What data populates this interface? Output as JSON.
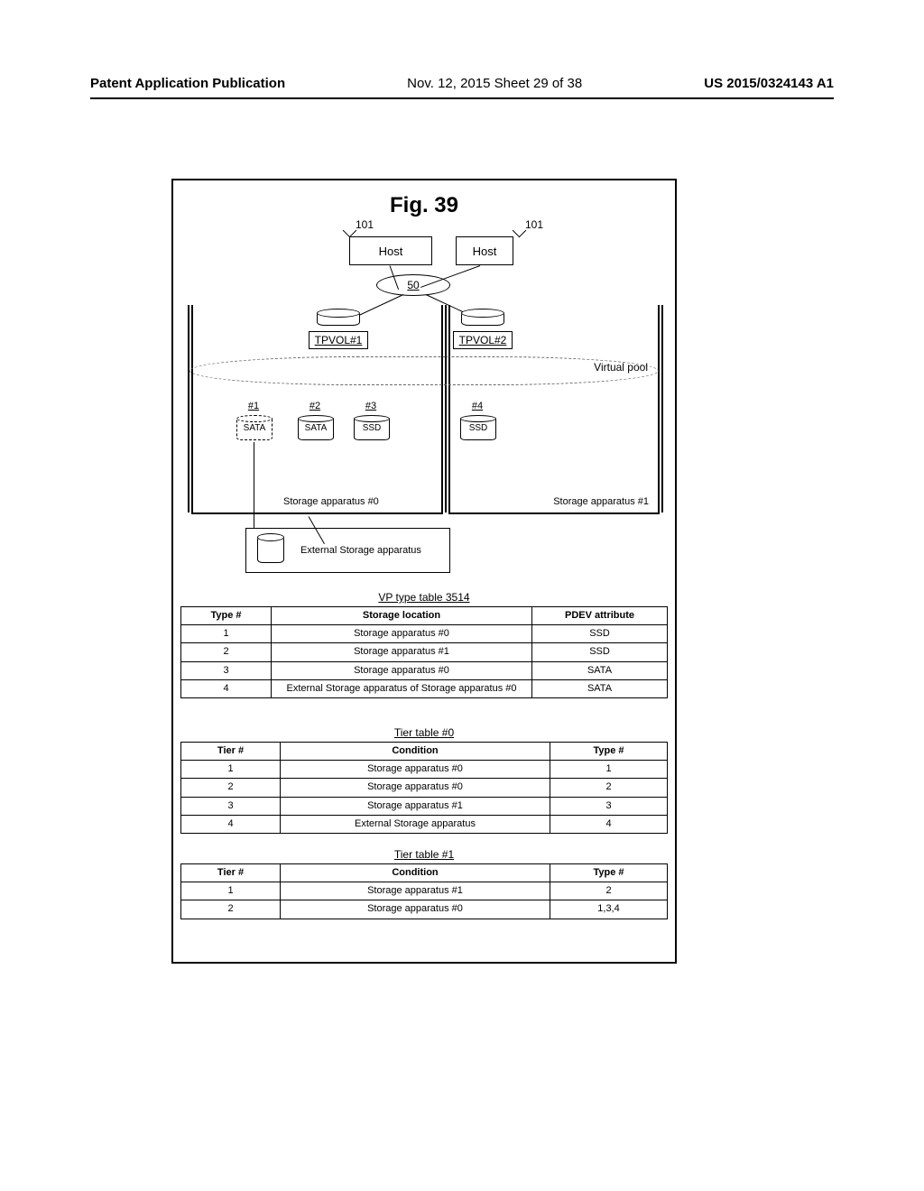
{
  "header": {
    "left_label": "Patent Application Publication",
    "center": "Nov. 12, 2015  Sheet 29 of 38",
    "right": "US 2015/0324143 A1"
  },
  "figure": {
    "title": "Fig. 39",
    "ref101": "101",
    "host1": "Host",
    "host2": "Host",
    "network": "50",
    "tpvol1": "TPVOL#1",
    "tpvol2": "TPVOL#2",
    "vpool": "Virtual pool",
    "app0_label": "Storage apparatus #0",
    "app1_label": "Storage apparatus #1",
    "ext_label": "External Storage apparatus",
    "disks": [
      {
        "num": "#1",
        "lbl": "SATA"
      },
      {
        "num": "#2",
        "lbl": "SATA"
      },
      {
        "num": "#3",
        "lbl": "SSD"
      },
      {
        "num": "#4",
        "lbl": "SSD"
      }
    ]
  },
  "vp_table": {
    "title": "VP type table  3514",
    "headers": [
      "Type #",
      "Storage location",
      "PDEV attribute"
    ],
    "rows": [
      [
        "1",
        "Storage apparatus #0",
        "SSD"
      ],
      [
        "2",
        "Storage apparatus #1",
        "SSD"
      ],
      [
        "3",
        "Storage apparatus #0",
        "SATA"
      ],
      [
        "4",
        "External Storage apparatus of Storage apparatus #0",
        "SATA"
      ]
    ]
  },
  "tier0": {
    "title": "Tier table #0",
    "headers": [
      "Tier #",
      "Condition",
      "Type #"
    ],
    "rows": [
      [
        "1",
        "Storage apparatus #0",
        "1"
      ],
      [
        "2",
        "Storage apparatus #0",
        "2"
      ],
      [
        "3",
        "Storage apparatus #1",
        "3"
      ],
      [
        "4",
        "External Storage apparatus",
        "4"
      ]
    ]
  },
  "tier1": {
    "title": "Tier table #1",
    "headers": [
      "Tier #",
      "Condition",
      "Type #"
    ],
    "rows": [
      [
        "1",
        "Storage apparatus #1",
        "2"
      ],
      [
        "2",
        "Storage apparatus #0",
        "1,3,4"
      ]
    ]
  }
}
